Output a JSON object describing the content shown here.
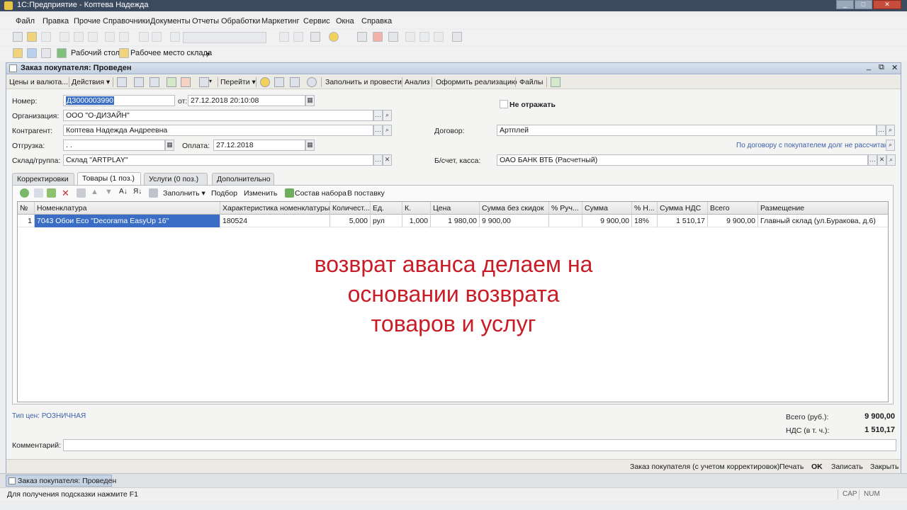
{
  "window": {
    "title": "1С:Предприятие - Коптева Надежда"
  },
  "menu": [
    "Файл",
    "Правка",
    "Прочие",
    "Справочники",
    "Документы",
    "Отчеты",
    "Обработки",
    "Маркетинг",
    "Сервис",
    "Окна",
    "Справка"
  ],
  "toolbar2": {
    "desktop": "Рабочий стол",
    "warehouse": "Рабочее место склада"
  },
  "doc": {
    "title": "Заказ покупателя: Проведен",
    "toolbar": {
      "prices": "Цены и валюта...",
      "actions": "Действия",
      "goto": "Перейти",
      "fill_post": "Заполнить и провести",
      "analysis": "Анализ",
      "realization": "Оформить реализацию",
      "files": "Файлы"
    },
    "fields": {
      "number_label": "Номер:",
      "number_value": "ДЗ000003990",
      "from_label": "от:",
      "from_value": "27.12.2018 20:10:08",
      "org_label": "Организация:",
      "org_value": "ООО \"О-ДИЗАЙН\"",
      "contragent_label": "Контрагент:",
      "contragent_value": "Коптева Надежда Андреевна",
      "shipment_label": "Отгрузка:",
      "shipment_value": ". .",
      "payment_label": "Оплата:",
      "payment_value": "27.12.2018",
      "warehouse_label": "Склад/группа:",
      "warehouse_value": "Склад \"ARTPLAY\"",
      "no_reflect_label": "Не отражать",
      "contract_label": "Договор:",
      "contract_value": "Артплей",
      "debt_link": "По договору с покупателем долг не рассчитан",
      "account_label": "Б/счет, касса:",
      "account_value": "ОАО БАНК ВТБ (Расчетный)"
    },
    "tabs": [
      "Корректировки",
      "Товары (1 поз.)",
      "Услуги (0 поз.)",
      "Дополнительно"
    ],
    "table_toolbar": {
      "fill": "Заполнить",
      "pick": "Подбор",
      "change": "Изменить",
      "kit": "Состав набора",
      "to_delivery": "В поставку"
    },
    "columns": [
      "№",
      "Номенклатура",
      "Характеристика номенклатуры",
      "Количест...",
      "Ед.",
      "К.",
      "Цена",
      "Сумма без скидок",
      "% Руч...",
      "Сумма",
      "% Н...",
      "Сумма НДС",
      "Всего",
      "Размещение"
    ],
    "rows": [
      [
        "1",
        "7043 Обои Eco \"Decorama EasyUp 16\"",
        "180524",
        "5,000",
        "рул",
        "1,000",
        "1 980,00",
        "9 900,00",
        "",
        "9 900,00",
        "18%",
        "1 510,17",
        "9 900,00",
        "Главный склад (ул.Буракова, д.6)"
      ]
    ],
    "price_type": "Тип цен: РОЗНИЧНАЯ",
    "totals": {
      "total_label": "Всего (руб.):",
      "total_value": "9 900,00",
      "vat_label": "НДС (в т. ч.):",
      "vat_value": "1 510,17"
    },
    "comment_label": "Комментарий:",
    "bottom": {
      "order_corr": "Заказ покупателя (с учетом корректировок)",
      "print": "Печать",
      "ok": "OK",
      "save": "Записать",
      "close": "Закрыть"
    }
  },
  "overlay_text": [
    "возврат аванса делаем на",
    "основании возврата",
    "товаров и услуг"
  ],
  "taskbar": {
    "item": "Заказ покупателя: Проведен"
  },
  "status": {
    "hint": "Для получения подсказки нажмите F1",
    "cap": "CAP",
    "num": "NUM"
  },
  "colors": {
    "overlay": "#c81c26",
    "selection": "#3a6dc4",
    "link": "#3b5fa8"
  }
}
